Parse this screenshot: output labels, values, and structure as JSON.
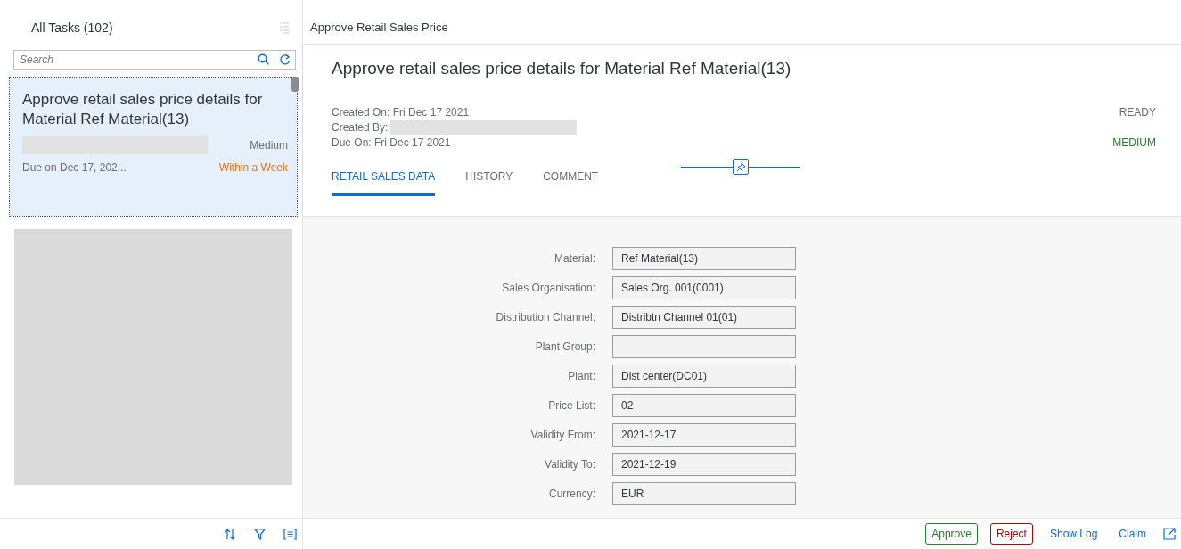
{
  "master": {
    "title": "All Tasks (102)",
    "search": {
      "placeholder": "Search"
    },
    "tasks": [
      {
        "title": "Approve retail sales price details for Material Ref Material(13)",
        "sender_redacted": true,
        "priority": "Medium",
        "due": "Due on Dec 17, 202...",
        "due_status": "Within a Week",
        "selected": true
      }
    ]
  },
  "detail": {
    "header_title": "Approve Retail Sales Price",
    "title": "Approve retail sales price details for Material Ref Material(13)",
    "meta": [
      {
        "text": "Created On: Fri Dec 17 2021",
        "redacted": false
      },
      {
        "text": "Created By:",
        "redacted": true
      },
      {
        "text": "Due On: Fri Dec 17 2021",
        "redacted": false
      }
    ],
    "status": "READY",
    "priority": "MEDIUM",
    "tabs": [
      {
        "label": "RETAIL SALES DATA",
        "selected": true
      },
      {
        "label": "HISTORY",
        "selected": false
      },
      {
        "label": "COMMENT",
        "selected": false
      }
    ],
    "fields": [
      {
        "label": "Material:",
        "value": "Ref Material(13)"
      },
      {
        "label": "Sales Organisation:",
        "value": "Sales Org. 001(0001)"
      },
      {
        "label": "Distribution Channel:",
        "value": "Distribtn Channel 01(01)"
      },
      {
        "label": "Plant Group:"
      },
      {
        "label": "Plant:",
        "value": "Dist center(DC01)"
      },
      {
        "label": "Price List:",
        "value": "02"
      },
      {
        "label": "Validity From:",
        "value": "2021-12-17"
      },
      {
        "label": "Validity To:",
        "value": "2021-12-19"
      },
      {
        "label": "Currency:",
        "value": "EUR"
      }
    ],
    "actions": [
      {
        "label": "Approve",
        "kind": "accept"
      },
      {
        "label": "Reject",
        "kind": "reject"
      },
      {
        "label": "Show Log",
        "kind": "plain"
      },
      {
        "label": "Claim",
        "kind": "plain"
      }
    ]
  }
}
